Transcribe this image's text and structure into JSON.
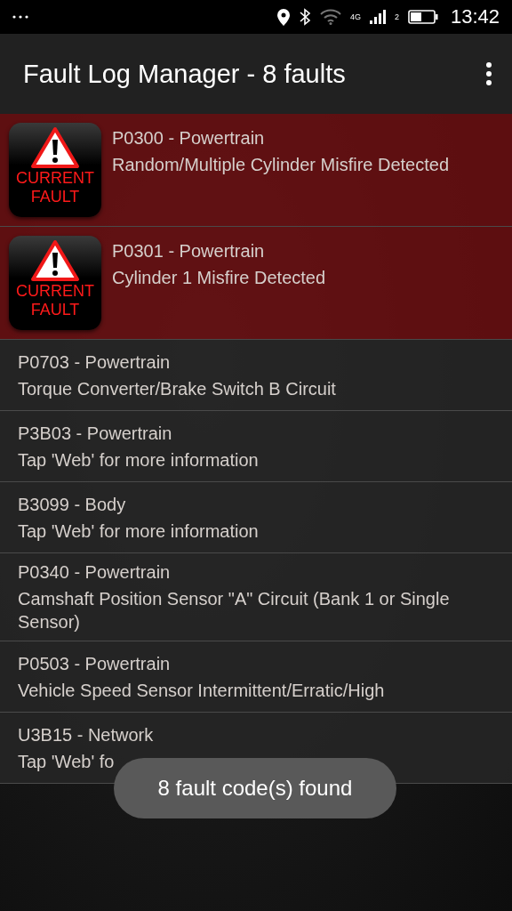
{
  "status_bar": {
    "network_type": "4G",
    "sim": "2",
    "time": "13:42"
  },
  "app_bar": {
    "title": "Fault Log Manager - 8 faults"
  },
  "faults": [
    {
      "code": "P0300 - Powertrain",
      "description": "Random/Multiple Cylinder Misfire Detected",
      "current": true,
      "badge": [
        "CURRENT",
        "FAULT"
      ]
    },
    {
      "code": "P0301 - Powertrain",
      "description": "Cylinder 1 Misfire Detected",
      "current": true,
      "badge": [
        "CURRENT",
        "FAULT"
      ]
    },
    {
      "code": "P0703 - Powertrain",
      "description": "Torque Converter/Brake Switch B Circuit",
      "current": false
    },
    {
      "code": "P3B03 - Powertrain",
      "description": "Tap 'Web' for more information",
      "current": false
    },
    {
      "code": "B3099 - Body",
      "description": "Tap 'Web' for more information",
      "current": false
    },
    {
      "code": "P0340 - Powertrain",
      "description": "Camshaft Position Sensor \"A\" Circuit (Bank 1 or Single Sensor)",
      "current": false
    },
    {
      "code": "P0503 - Powertrain",
      "description": "Vehicle Speed Sensor Intermittent/Erratic/High",
      "current": false
    },
    {
      "code": "U3B15 - Network",
      "description": "Tap 'Web' fo",
      "current": false
    }
  ],
  "toast": {
    "text": "8 fault code(s) found"
  }
}
